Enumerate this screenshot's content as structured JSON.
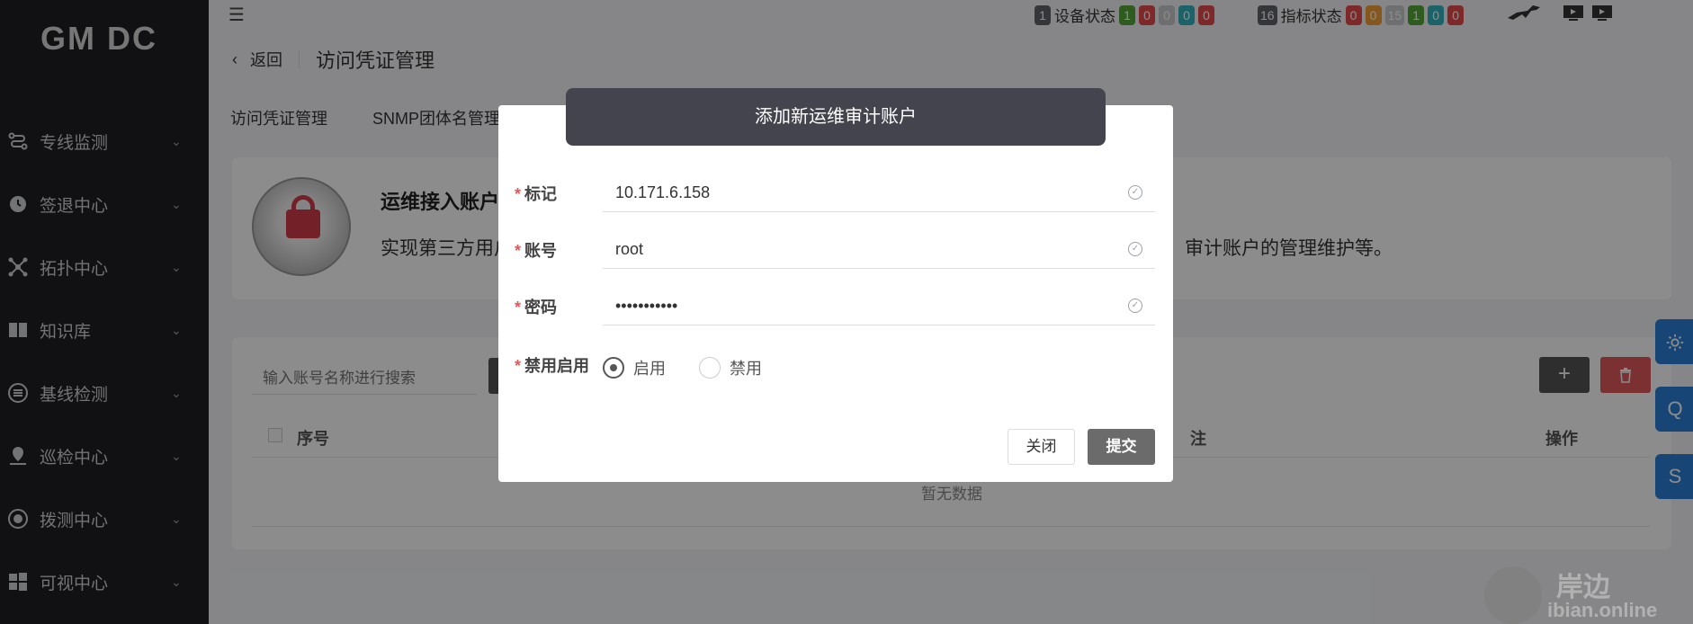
{
  "app": {
    "logo": "GM DC"
  },
  "sidebar": {
    "partial_item": "",
    "items": [
      {
        "label": "专线监测",
        "icon": "route-icon"
      },
      {
        "label": "签退中心",
        "icon": "clock-icon"
      },
      {
        "label": "拓扑中心",
        "icon": "topology-icon"
      },
      {
        "label": "知识库",
        "icon": "book-icon"
      },
      {
        "label": "基线检测",
        "icon": "list-icon"
      },
      {
        "label": "巡检中心",
        "icon": "location-icon"
      },
      {
        "label": "拨测中心",
        "icon": "probe-icon"
      },
      {
        "label": "可视中心",
        "icon": "windows-icon"
      }
    ]
  },
  "topbar": {
    "device_status": {
      "count": "1",
      "label": "设备状态",
      "values": [
        "1",
        "0",
        "0",
        "0",
        "0"
      ]
    },
    "metric_status": {
      "count": "16",
      "label": "指标状态",
      "values": [
        "0",
        "0",
        "15",
        "1",
        "0",
        "0"
      ]
    }
  },
  "header": {
    "back": "返回",
    "title": "访问凭证管理"
  },
  "tabs": [
    "访问凭证管理",
    "SNMP团体名管理"
  ],
  "info_card": {
    "title": "运维接入账户",
    "desc_left": "实现第三方用户",
    "desc_right": "审计账户的管理维护等。"
  },
  "table": {
    "search_placeholder": "输入账号名称进行搜索",
    "col_index": "序号",
    "col_middle": "注",
    "col_action": "操作",
    "empty": "暂无数据",
    "add_label": "+"
  },
  "float_buttons": {
    "q": "Q",
    "s": "S"
  },
  "modal": {
    "title": "添加新运维审计账户",
    "fields": {
      "tag": {
        "label": "标记",
        "value": "10.171.6.158"
      },
      "account": {
        "label": "账号",
        "value": "root"
      },
      "password": {
        "label": "密码",
        "value": "•••••••••••"
      },
      "status": {
        "label": "禁用启用",
        "enable": "启用",
        "disable": "禁用",
        "selected": "启用"
      }
    },
    "close": "关闭",
    "submit": "提交"
  },
  "watermark": {
    "text1": "岸边",
    "text2": "ibian.online"
  },
  "colors": {
    "sidebar_bg": "#1f1f23",
    "modal_header": "#44444e",
    "float_blue": "#2a7ed8",
    "danger": "#e05a5a"
  }
}
